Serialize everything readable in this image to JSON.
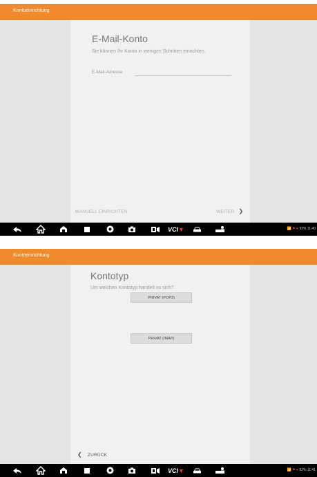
{
  "screen1": {
    "title": "Kontoeinrichtung",
    "heading": "E-Mail-Konto",
    "subtitle": "Sie können Ihr Konto in wenigen Schritten einrichten.",
    "email_label": "E-Mail-Adresse",
    "email_value": "",
    "manual_setup": "MANUELL EINRICHTEN",
    "next": "WEITER",
    "status": {
      "signal": "📶 ⚑ ●",
      "battery": "93%",
      "time": "11:40"
    }
  },
  "screen2": {
    "title": "Kontoeinrichtung",
    "heading": "Kontotyp",
    "subtitle": "Um welchen Kontotyp handelt es sich?",
    "option_pop3": "PRIVAT (POP3)",
    "option_imap": "PRIVAT (IMAP)",
    "back": "ZURÜCK",
    "status": {
      "signal": "📶 ⚑ ●",
      "battery": "92%",
      "time": "11:41"
    }
  },
  "navbar": {
    "icons": [
      "back-arrow-icon",
      "diagnostics-icon",
      "home-icon",
      "recent-apps-icon",
      "chrome-icon",
      "camera-icon",
      "screen-record-icon",
      "vci-icon",
      "car-icon",
      "service-icon"
    ],
    "vci_label": "VCI"
  },
  "colors": {
    "accent": "#f08a2c",
    "navbar": "#000000",
    "sheet": "#f1f1f1"
  }
}
